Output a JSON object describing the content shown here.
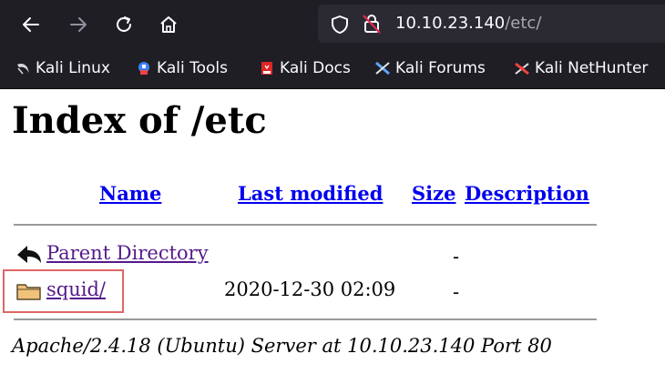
{
  "browser": {
    "url_host": "10.10.23.140",
    "url_path": "/etc/",
    "bookmarks": [
      {
        "label": "Kali Linux",
        "icon": "kali-dragon-icon"
      },
      {
        "label": "Kali Tools",
        "icon": "kali-tools-icon"
      },
      {
        "label": "Kali Docs",
        "icon": "kali-docs-icon"
      },
      {
        "label": "Kali Forums",
        "icon": "kali-forums-icon"
      },
      {
        "label": "Kali NetHunter",
        "icon": "kali-nethunter-icon"
      }
    ]
  },
  "page": {
    "title": "Index of /etc",
    "columns": {
      "name": "Name",
      "last_modified": "Last modified",
      "size": "Size",
      "description": "Description"
    },
    "rows": [
      {
        "name": "Parent Directory",
        "last_modified": "",
        "size": "-",
        "icon": "back-arrow-icon"
      },
      {
        "name": "squid/",
        "last_modified": "2020-12-30 02:09",
        "size": "-",
        "icon": "folder-icon"
      }
    ],
    "footer": "Apache/2.4.18 (Ubuntu) Server at 10.10.23.140 Port 80"
  },
  "colors": {
    "chrome_bg": "#1f1e25",
    "link": "#0000ee",
    "visited_link": "#551a8b",
    "highlight": "#e06666"
  }
}
